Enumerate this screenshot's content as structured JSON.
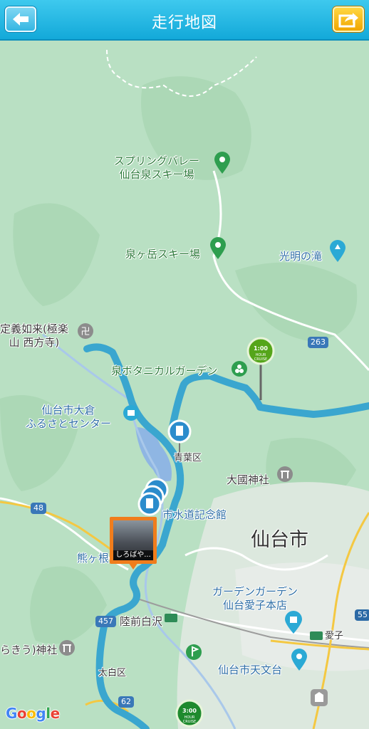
{
  "header": {
    "title": "走行地図",
    "back_icon": "back-arrow-icon",
    "share_icon": "share-icon"
  },
  "map": {
    "labels": {
      "spring_valley_1": "スプリングバレー",
      "spring_valley_2": "仙台泉スキー場",
      "izumigatake": "泉ヶ岳スキー場",
      "komyo": "光明の滝",
      "jogi_1": "定義如来(極楽",
      "jogi_2": "山 西方寺)",
      "botanical": "泉ボタニカルガーデン",
      "okura_1": "仙台市大倉",
      "okura_2": "ふるさとセンター",
      "aoba": "青葉区",
      "kunitama": "大國神社",
      "suido": "市水道記念館",
      "sendai": "仙台市",
      "kumagane": "熊ヶ根",
      "garden_1": "ガーデンガーデン",
      "garden_2": "仙台愛子本店",
      "rikuzen": "陸前白沢",
      "ayashi": "愛子",
      "shrine_left": "らきう)神社",
      "taihaku": "太白区",
      "tenmon": "仙台市天文台",
      "google": "Google"
    },
    "road_numbers": {
      "r263": "263",
      "r48": "48",
      "r457": "457",
      "r55": "55",
      "r62": "62"
    },
    "markers": {
      "hour1": {
        "line1": "1:00",
        "line2": "HOUR",
        "line3": "CRUISE"
      },
      "hour3": {
        "line1": "3:00",
        "line2": "HOUR",
        "line3": "CRUISE"
      }
    },
    "photo_caption": "しろばや..."
  },
  "colors": {
    "header": "#13a9d9",
    "route": "#3aa6cf",
    "map_land": "#b9e0c3",
    "park_pin": "#2e9e4f",
    "poi_pin": "#2ba9d5"
  }
}
